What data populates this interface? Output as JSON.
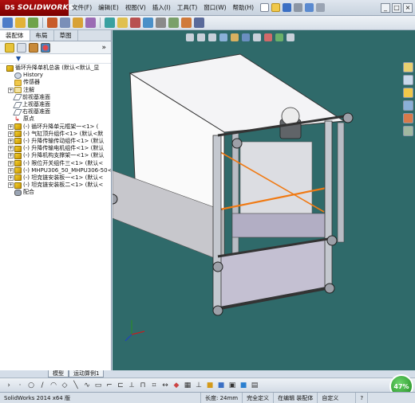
{
  "app": {
    "logo_text": "SOLIDWORKS",
    "logo_prefix": "DS"
  },
  "menu": [
    "文件(F)",
    "编辑(E)",
    "视图(V)",
    "插入(I)",
    "工具(T)",
    "窗口(W)",
    "帮助(H)"
  ],
  "window_buttons": [
    "_",
    "□",
    "×"
  ],
  "panel_tabs": [
    "装配体",
    "布局",
    "草图"
  ],
  "panel_collapse": "»",
  "filter_icon": "funnel-icon",
  "tree": {
    "root": "循环升降单机总装 (默认<默认_显",
    "items": [
      {
        "label": "History",
        "icon": "hist",
        "exp": ""
      },
      {
        "label": "传感器",
        "icon": "folder",
        "exp": ""
      },
      {
        "label": "注解",
        "icon": "note",
        "exp": "+"
      },
      {
        "label": "前视基准面",
        "icon": "plane",
        "exp": ""
      },
      {
        "label": "上视基准面",
        "icon": "plane",
        "exp": ""
      },
      {
        "label": "右视基准面",
        "icon": "plane",
        "exp": ""
      },
      {
        "label": "原点",
        "icon": "origin",
        "exp": ""
      },
      {
        "label": "(-) 循环升降单元框架一<1> (",
        "icon": "part",
        "exp": "+"
      },
      {
        "label": "(-) 气缸顶升组件<1> (默认<默",
        "icon": "part",
        "exp": "+"
      },
      {
        "label": "(-) 升降传输传动组件<1> (默认",
        "icon": "part",
        "exp": "+"
      },
      {
        "label": "(-) 升降传输电机组件<1> (默认",
        "icon": "part",
        "exp": "+"
      },
      {
        "label": "(-) 升降机构支撑架一<1> (默认",
        "icon": "part",
        "exp": "+"
      },
      {
        "label": "(-) 限位开关组件三<1> (默认<",
        "icon": "part",
        "exp": "+"
      },
      {
        "label": "(-) MHPU306_50_MHPU306-50<",
        "icon": "part",
        "exp": "+"
      },
      {
        "label": "(-) 坦克链安装板一<1> (默认<",
        "icon": "part",
        "exp": "+"
      },
      {
        "label": "(-) 坦克链安装板二<1> (默认<",
        "icon": "part",
        "exp": "+"
      },
      {
        "label": "配合",
        "icon": "mate",
        "exp": ""
      }
    ]
  },
  "model_tabs": [
    "模型",
    "运动算例1"
  ],
  "status": {
    "version": "SolidWorks 2014 x64 版",
    "length": "长度: 24mm",
    "defined": "完全定义",
    "editing": "在编辑 装配体",
    "custom": "自定义",
    "help": "?"
  },
  "progress": "47%",
  "colors": {
    "viewport_bg": "#2f6a6a",
    "frame_profile": "#b8bcc4",
    "panel_white": "#f4f4f6",
    "front_panel": "#c4c0d2",
    "orange_line": "#f07a14",
    "logo_red": "#a00000"
  }
}
